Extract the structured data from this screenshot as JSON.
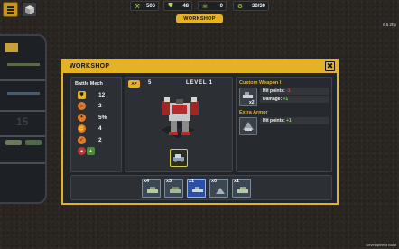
{
  "hud": {
    "resources": [
      {
        "icon": "wrench-icon",
        "value": "506"
      },
      {
        "icon": "shield-icon",
        "value": "48"
      },
      {
        "icon": "skull-icon",
        "value": "0"
      },
      {
        "icon": "robot-icon",
        "value": "30/30"
      }
    ],
    "tab_label": "WORKSHOP",
    "version": "0.6.2hp",
    "build_label": "Development Build"
  },
  "modal": {
    "title": "WORKSHOP",
    "close_label": "✖",
    "unit_name": "Battle Mech",
    "stats": [
      {
        "icon": "shield-stat-icon",
        "value": "12",
        "color": "#e5b126"
      },
      {
        "icon": "speed-stat-icon",
        "value": "2",
        "color": "#e07a2b"
      },
      {
        "icon": "crit-stat-icon",
        "value": "5%",
        "color": "#e07a2b"
      },
      {
        "icon": "attack-stat-icon",
        "value": "4",
        "color": "#e07a2b"
      },
      {
        "icon": "range-stat-icon",
        "value": "2",
        "color": "#e07a2b"
      },
      {
        "icon": "ability-stat-icon",
        "value": "",
        "color": "#b83a3a"
      }
    ],
    "ap_label": "AP",
    "ap_value": "5",
    "level_label": "LEVEL 1",
    "upgrades": [
      {
        "title": "Custom Weapon I",
        "badge": "x2",
        "lines": [
          {
            "label": "Hit points: ",
            "delta": "-1",
            "kind": "neg"
          },
          {
            "label": "Damage: ",
            "delta": "+1",
            "kind": "pos"
          }
        ]
      },
      {
        "title": "Extra Armor",
        "badge": "",
        "lines": [
          {
            "label": "Hit points: ",
            "delta": "+1",
            "kind": "pos"
          }
        ]
      }
    ],
    "inventory": [
      {
        "count": "x4",
        "selected": false
      },
      {
        "count": "x3",
        "selected": false
      },
      {
        "count": "x1",
        "selected": true
      },
      {
        "count": "x0",
        "selected": false
      },
      {
        "count": "x1",
        "selected": false
      }
    ]
  },
  "colors": {
    "accent": "#e5b126",
    "panel": "#2c3035",
    "selected": "#2b4ea6",
    "positive": "#7fd85a",
    "negative": "#e04040"
  }
}
